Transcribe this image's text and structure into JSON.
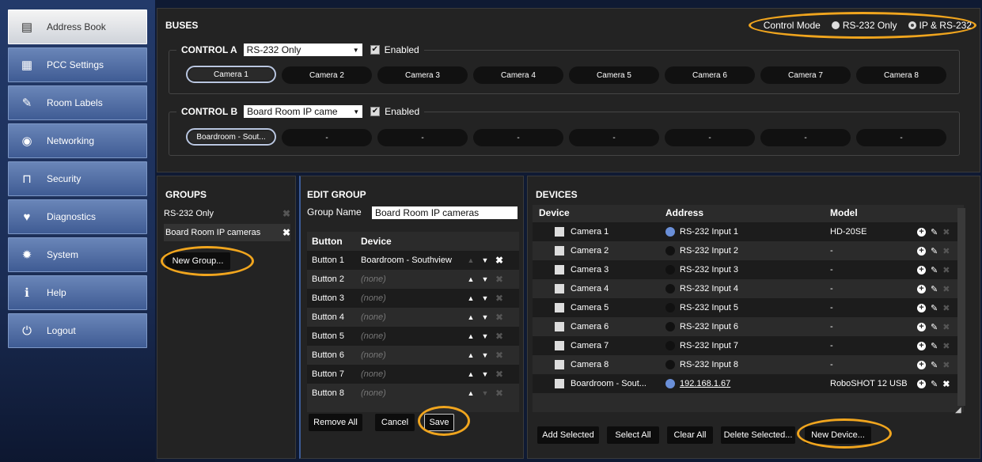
{
  "sidebar": {
    "items": [
      {
        "label": "Address Book",
        "icon": "address-book-icon",
        "glyph": "▤"
      },
      {
        "label": "PCC Settings",
        "icon": "settings-icon",
        "glyph": "▦"
      },
      {
        "label": "Room Labels",
        "icon": "pen-icon",
        "glyph": "✎"
      },
      {
        "label": "Networking",
        "icon": "globe-icon",
        "glyph": "◉"
      },
      {
        "label": "Security",
        "icon": "lock-icon",
        "glyph": "⊓"
      },
      {
        "label": "Diagnostics",
        "icon": "pulse-icon",
        "glyph": "♥"
      },
      {
        "label": "System",
        "icon": "gear-icon",
        "glyph": "✹"
      },
      {
        "label": "Help",
        "icon": "info-icon",
        "glyph": "ℹ"
      },
      {
        "label": "Logout",
        "icon": "power-icon",
        "glyph": "⏻"
      }
    ]
  },
  "buses": {
    "title": "BUSES",
    "control_mode_label": "Control Mode",
    "mode_options": [
      "RS-232 Only",
      "IP & RS-232"
    ],
    "control_a": {
      "name": "CONTROL A",
      "select": "RS-232 Only",
      "enabled": "Enabled",
      "buttons": [
        "Camera 1",
        "Camera 2",
        "Camera 3",
        "Camera 4",
        "Camera 5",
        "Camera 6",
        "Camera 7",
        "Camera 8"
      ]
    },
    "control_b": {
      "name": "CONTROL B",
      "select": "Board Room IP came",
      "enabled": "Enabled",
      "buttons": [
        "Boardroom - Sout...",
        "-",
        "-",
        "-",
        "-",
        "-",
        "-",
        "-"
      ]
    }
  },
  "groups": {
    "title": "GROUPS",
    "items": [
      "RS-232 Only",
      "Board Room IP cameras"
    ],
    "new_button": "New Group..."
  },
  "edit_group": {
    "title": "EDIT GROUP",
    "name_label": "Group Name",
    "name_value": "Board Room IP cameras",
    "col_button": "Button",
    "col_device": "Device",
    "rows": [
      {
        "button": "Button 1",
        "device": "Boardroom - Southview"
      },
      {
        "button": "Button 2",
        "device": "(none)"
      },
      {
        "button": "Button 3",
        "device": "(none)"
      },
      {
        "button": "Button 4",
        "device": "(none)"
      },
      {
        "button": "Button 5",
        "device": "(none)"
      },
      {
        "button": "Button 6",
        "device": "(none)"
      },
      {
        "button": "Button 7",
        "device": "(none)"
      },
      {
        "button": "Button 8",
        "device": "(none)"
      }
    ],
    "remove_all": "Remove All",
    "cancel": "Cancel",
    "save": "Save"
  },
  "devices": {
    "title": "DEVICES",
    "col_device": "Device",
    "col_address": "Address",
    "col_model": "Model",
    "rows": [
      {
        "device": "Camera 1",
        "address": "RS-232 Input 1",
        "model": "HD-20SE"
      },
      {
        "device": "Camera 2",
        "address": "RS-232 Input 2",
        "model": "-"
      },
      {
        "device": "Camera 3",
        "address": "RS-232 Input 3",
        "model": "-"
      },
      {
        "device": "Camera 4",
        "address": "RS-232 Input 4",
        "model": "-"
      },
      {
        "device": "Camera 5",
        "address": "RS-232 Input 5",
        "model": "-"
      },
      {
        "device": "Camera 6",
        "address": "RS-232 Input 6",
        "model": "-"
      },
      {
        "device": "Camera 7",
        "address": "RS-232 Input 7",
        "model": "-"
      },
      {
        "device": "Camera 8",
        "address": "RS-232 Input 8",
        "model": "-"
      },
      {
        "device": "Boardroom - Sout...",
        "address": "192.168.1.67",
        "model": "RoboSHOT 12 USB"
      }
    ],
    "add_selected": "Add Selected",
    "select_all": "Select All",
    "clear_all": "Clear All",
    "delete_selected": "Delete Selected...",
    "new_device": "New Device..."
  }
}
